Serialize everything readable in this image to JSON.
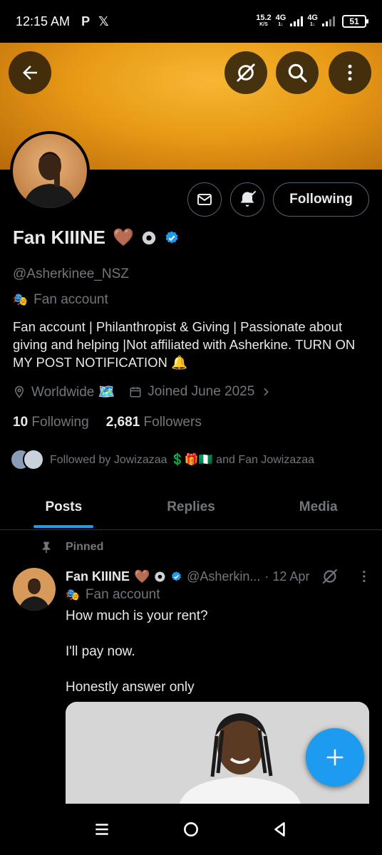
{
  "status_bar": {
    "time": "12:15 AM",
    "app_icons": [
      "P",
      "𝕏"
    ],
    "speed_value": "15.2",
    "speed_unit": "K/S",
    "network_1": "4G",
    "network_2": "4G",
    "battery": "51"
  },
  "profile": {
    "display_name": "Fan KIIINE",
    "name_emoji": "🤎",
    "handle": "@Asherkinee_NSZ",
    "account_label": "Fan account",
    "bio": "Fan account | Philanthropist & Giving | Passionate about giving and helping |Not affiliated with Asherkine. TURN ON MY POST NOTIFICATION 🔔",
    "location": "Worldwide 🗺️",
    "joined": "Joined June 2025",
    "following_count": "10",
    "following_label": "Following",
    "followers_count": "2,681",
    "followers_label": "Followers",
    "followed_by": "Followed by Jowizazaa 💲🎁🇳🇬 and Fan Jowizazaa",
    "follow_button": "Following"
  },
  "tabs": [
    "Posts",
    "Replies",
    "Media"
  ],
  "post": {
    "pinned_label": "Pinned",
    "author": "Fan KIIINE",
    "author_emoji": "🤎",
    "handle": "@Asherkin...",
    "date": "· 12 Apr",
    "account_label": "Fan account",
    "lines": [
      "How much is your rent?",
      "I'll pay now.",
      "Honestly answer only"
    ]
  },
  "colors": {
    "accent": "#1d9bf0",
    "background": "#000000",
    "secondary_text": "#71767b",
    "banner": "#f0a020"
  },
  "icons": {
    "back": "arrow-left-icon",
    "grok": "grok-icon",
    "search": "search-icon",
    "more": "more-vertical-icon",
    "message": "mail-icon",
    "notify": "bell-check-icon",
    "fab": "plus-icon"
  }
}
